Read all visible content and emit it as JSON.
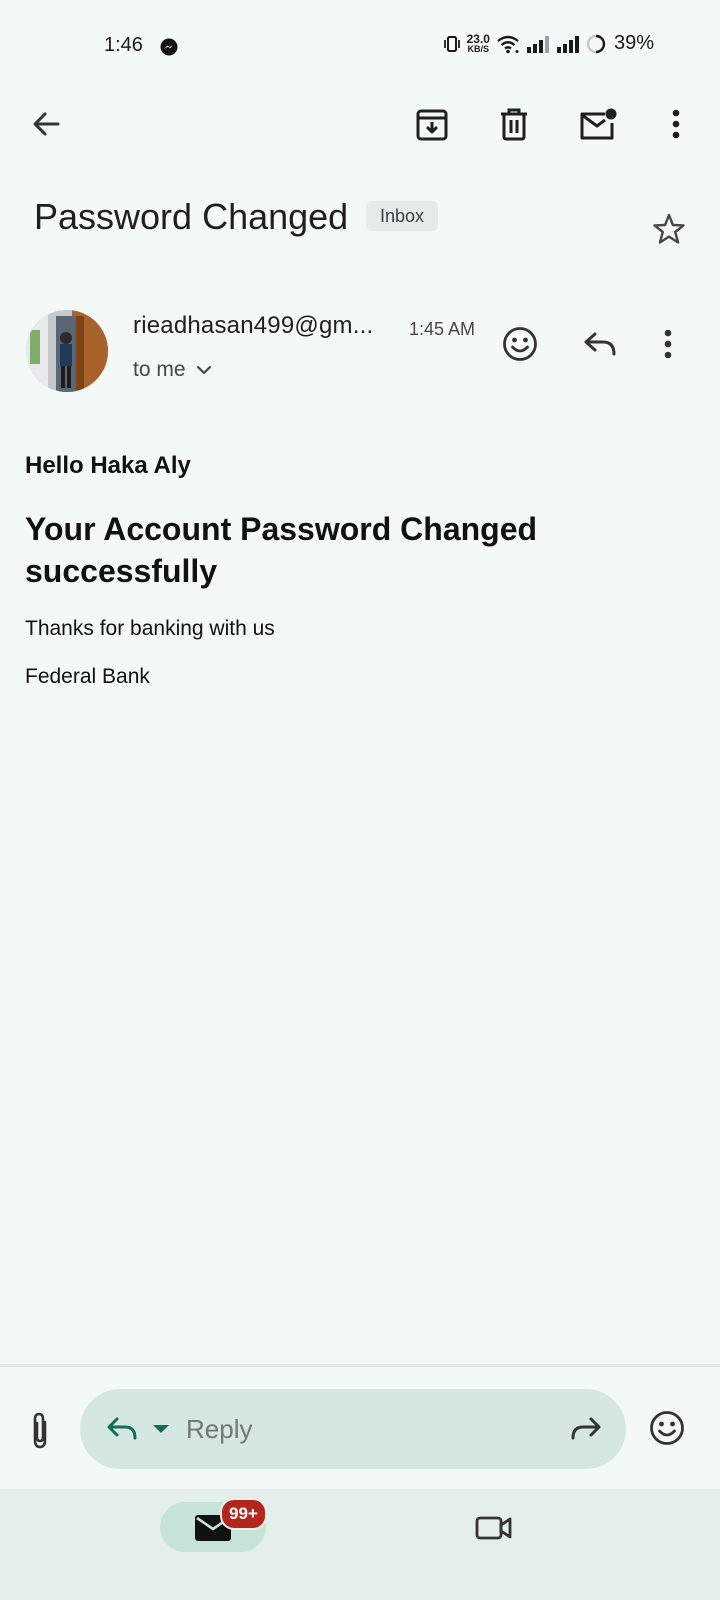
{
  "status_bar": {
    "time": "1:46",
    "net_speed_value": "23.0",
    "net_speed_unit": "KB/S",
    "battery": "39%"
  },
  "toolbar": {
    "icons": [
      "back-arrow-icon",
      "archive-icon",
      "delete-icon",
      "mark-unread-icon",
      "more-vert-icon"
    ]
  },
  "email": {
    "subject": "Password Changed",
    "label": "Inbox",
    "sender": "rieadhasan499@gm...",
    "time": "1:45 AM",
    "recipient": "to me",
    "body": {
      "greeting": "Hello Haka Aly",
      "headline": "Your Account Password Changed successfully",
      "line1": "Thanks for banking with us",
      "line2": "Federal Bank"
    }
  },
  "reply_bar": {
    "placeholder": "Reply"
  },
  "bottom_nav": {
    "mail_badge": "99+"
  },
  "colors": {
    "background": "#f3f9f6",
    "reply_pill": "#d5e7e1",
    "accent_green": "#146c54",
    "badge": "#b3261e",
    "nav_active": "#c7e3d8"
  }
}
